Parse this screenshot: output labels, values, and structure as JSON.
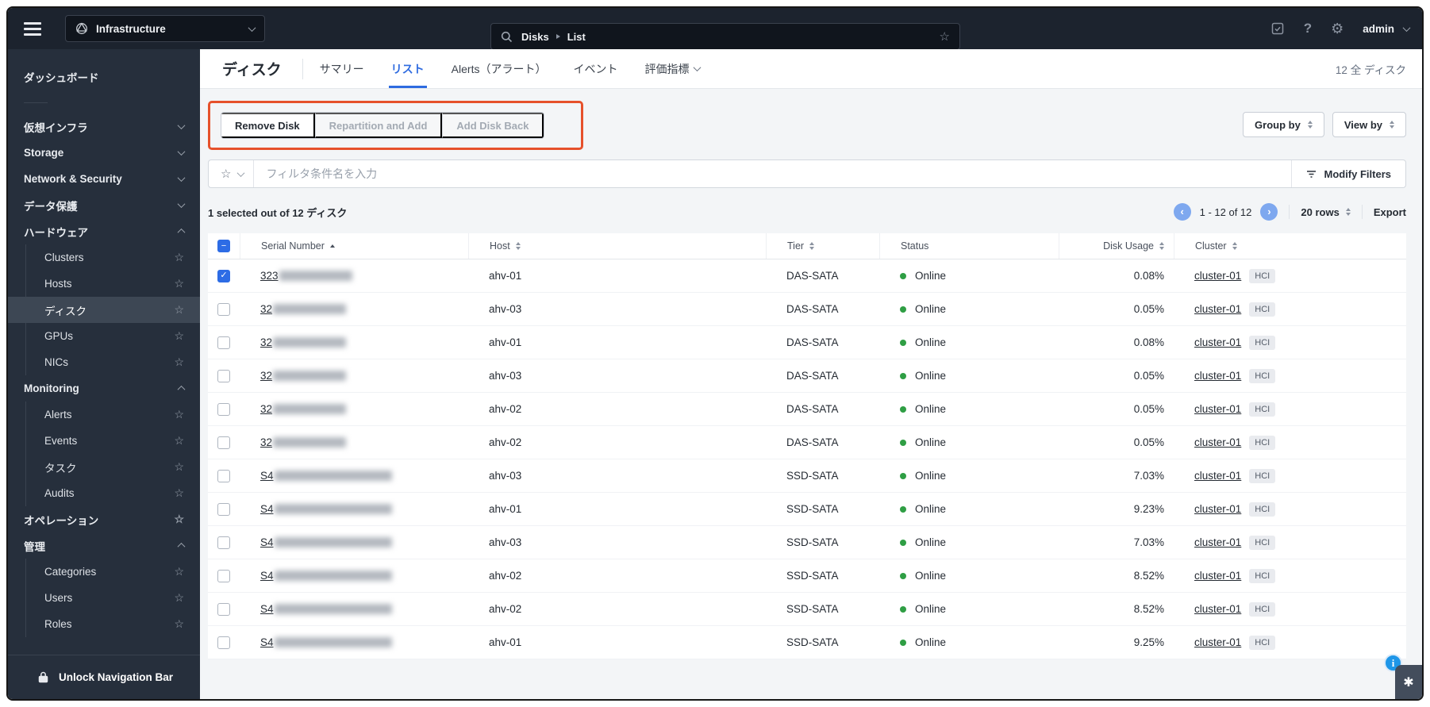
{
  "colors": {
    "accent": "#2e6be0",
    "annotation": "#e6512b",
    "status_online": "#2f9e44",
    "topbar_bg": "#1c232e",
    "sidebar_bg": "#262f3c",
    "sidebar_selected_bg": "#3d4754",
    "content_bg": "#f3f5f7"
  },
  "icons": {
    "hamburger": "hamburger-menu-icon",
    "app": "infrastructure-globe-icon",
    "search": "search-icon",
    "favorite": "star-icon",
    "tasks": "clipboard-check-icon",
    "help": "question-mark-icon",
    "settings": "gear-icon",
    "lock": "lock-icon",
    "filter": "funnel-icon",
    "info": "info-icon",
    "assist": "sparkle-asterisk-icon"
  },
  "topbar": {
    "app_label": "Infrastructure",
    "search": {
      "crumb1": "Disks",
      "crumb2": "List"
    },
    "user": "admin"
  },
  "sidebar": {
    "items": [
      {
        "id": "dashboard",
        "label": "ダッシュボード",
        "type": "top"
      },
      {
        "divider": true
      },
      {
        "id": "virtual-infra",
        "label": "仮想インフラ",
        "type": "top",
        "chevron": "down"
      },
      {
        "id": "storage",
        "label": "Storage",
        "type": "top",
        "chevron": "down"
      },
      {
        "id": "network-security",
        "label": "Network & Security",
        "type": "top",
        "chevron": "down"
      },
      {
        "id": "data-protection",
        "label": "データ保護",
        "type": "top",
        "chevron": "down"
      },
      {
        "id": "hardware",
        "label": "ハードウェア",
        "type": "top",
        "chevron": "up"
      },
      {
        "id": "clusters",
        "label": "Clusters",
        "type": "sub",
        "star": true
      },
      {
        "id": "hosts",
        "label": "Hosts",
        "type": "sub",
        "star": true
      },
      {
        "id": "disks",
        "label": "ディスク",
        "type": "sub",
        "star": true,
        "selected": true
      },
      {
        "id": "gpus",
        "label": "GPUs",
        "type": "sub",
        "star": true
      },
      {
        "id": "nics",
        "label": "NICs",
        "type": "sub",
        "star": true
      },
      {
        "id": "monitoring",
        "label": "Monitoring",
        "type": "top",
        "chevron": "up"
      },
      {
        "id": "alerts",
        "label": "Alerts",
        "type": "sub",
        "star": true
      },
      {
        "id": "events",
        "label": "Events",
        "type": "sub",
        "star": true
      },
      {
        "id": "tasks",
        "label": "タスク",
        "type": "sub",
        "star": true
      },
      {
        "id": "audits",
        "label": "Audits",
        "type": "sub",
        "star": true
      },
      {
        "id": "operations",
        "label": "オペレーション",
        "type": "top",
        "star": true
      },
      {
        "id": "administration",
        "label": "管理",
        "type": "top",
        "chevron": "up"
      },
      {
        "id": "categories",
        "label": "Categories",
        "type": "sub",
        "star": true
      },
      {
        "id": "users",
        "label": "Users",
        "type": "sub",
        "star": true
      },
      {
        "id": "roles",
        "label": "Roles",
        "type": "sub",
        "star": true
      }
    ],
    "footer_label": "Unlock Navigation Bar"
  },
  "header": {
    "title": "ディスク",
    "tabs": [
      {
        "id": "summary",
        "label": "サマリー"
      },
      {
        "id": "list",
        "label": "リスト",
        "active": true
      },
      {
        "id": "alerts",
        "label": "Alerts（アラート）"
      },
      {
        "id": "events",
        "label": "イベント"
      },
      {
        "id": "metrics",
        "label": "評価指標",
        "dropdown": true
      }
    ],
    "count_label": "12 全 ディスク"
  },
  "toolbar": {
    "actions": [
      {
        "id": "remove-disk",
        "label": "Remove Disk",
        "enabled": true
      },
      {
        "id": "repartition-add",
        "label": "Repartition and Add",
        "enabled": false
      },
      {
        "id": "add-disk-back",
        "label": "Add Disk Back",
        "enabled": false
      }
    ],
    "group_by_label": "Group by",
    "view_by_label": "View by"
  },
  "filter": {
    "placeholder": "フィルタ条件名を入力",
    "modify_filters_label": "Modify Filters"
  },
  "selection": {
    "summary": "1 selected out of 12 ディスク",
    "pagination": "1 - 12 of 12",
    "rows_label": "20 rows",
    "export_label": "Export"
  },
  "table": {
    "columns": [
      {
        "label": "Serial Number",
        "sort": "asc"
      },
      {
        "label": "Host",
        "sort": "both"
      },
      {
        "label": "Tier",
        "sort": "both"
      },
      {
        "label": "Status",
        "sort": "none"
      },
      {
        "label": "Disk Usage",
        "sort": "both",
        "align": "right"
      },
      {
        "label": "Cluster",
        "sort": "both"
      }
    ],
    "select_all_state": "indeterminate",
    "rows": [
      {
        "checked": true,
        "serial_prefix": "323",
        "host": "ahv-01",
        "tier": "DAS-SATA",
        "status": "Online",
        "usage": "0.08%",
        "cluster": "cluster-01",
        "badge": "HCI"
      },
      {
        "checked": false,
        "serial_prefix": "32",
        "host": "ahv-03",
        "tier": "DAS-SATA",
        "status": "Online",
        "usage": "0.05%",
        "cluster": "cluster-01",
        "badge": "HCI"
      },
      {
        "checked": false,
        "serial_prefix": "32",
        "host": "ahv-01",
        "tier": "DAS-SATA",
        "status": "Online",
        "usage": "0.08%",
        "cluster": "cluster-01",
        "badge": "HCI"
      },
      {
        "checked": false,
        "serial_prefix": "32",
        "host": "ahv-03",
        "tier": "DAS-SATA",
        "status": "Online",
        "usage": "0.05%",
        "cluster": "cluster-01",
        "badge": "HCI"
      },
      {
        "checked": false,
        "serial_prefix": "32",
        "host": "ahv-02",
        "tier": "DAS-SATA",
        "status": "Online",
        "usage": "0.05%",
        "cluster": "cluster-01",
        "badge": "HCI"
      },
      {
        "checked": false,
        "serial_prefix": "32",
        "host": "ahv-02",
        "tier": "DAS-SATA",
        "status": "Online",
        "usage": "0.05%",
        "cluster": "cluster-01",
        "badge": "HCI"
      },
      {
        "checked": false,
        "serial_prefix": "S4",
        "host": "ahv-03",
        "tier": "SSD-SATA",
        "status": "Online",
        "usage": "7.03%",
        "cluster": "cluster-01",
        "badge": "HCI"
      },
      {
        "checked": false,
        "serial_prefix": "S4",
        "host": "ahv-01",
        "tier": "SSD-SATA",
        "status": "Online",
        "usage": "9.23%",
        "cluster": "cluster-01",
        "badge": "HCI"
      },
      {
        "checked": false,
        "serial_prefix": "S4",
        "host": "ahv-03",
        "tier": "SSD-SATA",
        "status": "Online",
        "usage": "7.03%",
        "cluster": "cluster-01",
        "badge": "HCI"
      },
      {
        "checked": false,
        "serial_prefix": "S4",
        "host": "ahv-02",
        "tier": "SSD-SATA",
        "status": "Online",
        "usage": "8.52%",
        "cluster": "cluster-01",
        "badge": "HCI"
      },
      {
        "checked": false,
        "serial_prefix": "S4",
        "host": "ahv-02",
        "tier": "SSD-SATA",
        "status": "Online",
        "usage": "8.52%",
        "cluster": "cluster-01",
        "badge": "HCI"
      },
      {
        "checked": false,
        "serial_prefix": "S4",
        "host": "ahv-01",
        "tier": "SSD-SATA",
        "status": "Online",
        "usage": "9.25%",
        "cluster": "cluster-01",
        "badge": "HCI"
      }
    ]
  }
}
